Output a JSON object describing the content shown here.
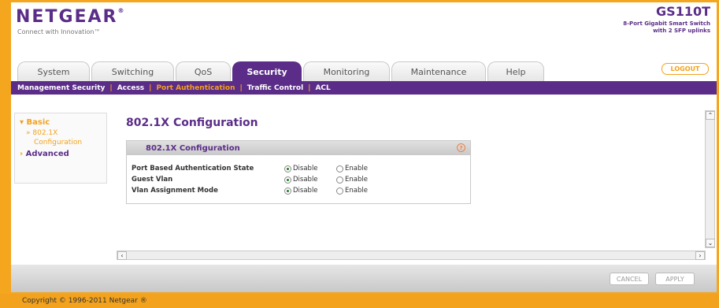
{
  "header": {
    "logo": "NETGEAR",
    "logo_mark": "®",
    "tagline": "Connect with Innovation™",
    "model": "GS110T",
    "model_desc": "8-Port Gigabit Smart Switch with 2 SFP uplinks",
    "logout_label": "LOGOUT"
  },
  "tabs": [
    {
      "label": "System"
    },
    {
      "label": "Switching"
    },
    {
      "label": "QoS"
    },
    {
      "label": "Security"
    },
    {
      "label": "Monitoring"
    },
    {
      "label": "Maintenance"
    },
    {
      "label": "Help"
    }
  ],
  "subnav": [
    {
      "label": "Management Security"
    },
    {
      "label": "Access"
    },
    {
      "label": "Port Authentication"
    },
    {
      "label": "Traffic Control"
    },
    {
      "label": "ACL"
    }
  ],
  "sidebar": {
    "basic": "Basic",
    "item1": "802.1X",
    "item1b": "Configuration",
    "advanced": "Advanced"
  },
  "content": {
    "title": "802.1X Configuration",
    "panel_title": "802.1X Configuration",
    "rows": [
      {
        "label": "Port Based Authentication State",
        "opt1": "Disable",
        "opt2": "Enable"
      },
      {
        "label": "Guest Vlan",
        "opt1": "Disable",
        "opt2": "Enable"
      },
      {
        "label": "Vlan Assignment Mode",
        "opt1": "Disable",
        "opt2": "Enable"
      }
    ]
  },
  "buttons": {
    "cancel": "CANCEL",
    "apply": "APPLY"
  },
  "footer": "Copyright © 1996-2011 Netgear ®"
}
